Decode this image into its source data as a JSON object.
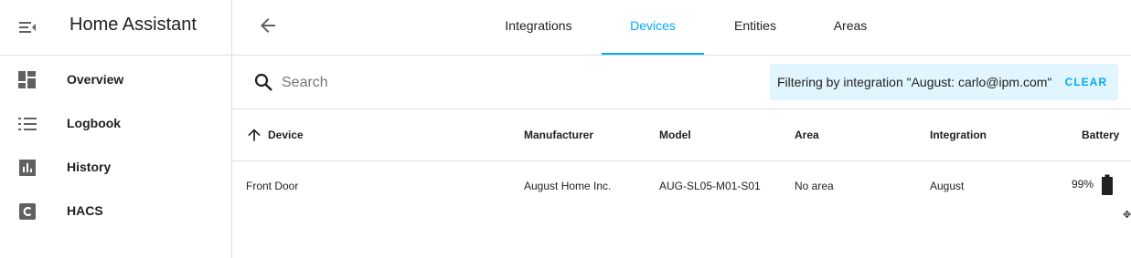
{
  "sidebar": {
    "title": "Home Assistant",
    "items": [
      {
        "label": "Overview",
        "icon": "dashboard-icon"
      },
      {
        "label": "Logbook",
        "icon": "logbook-icon"
      },
      {
        "label": "History",
        "icon": "history-chart-icon"
      },
      {
        "label": "HACS",
        "icon": "hacs-icon"
      }
    ]
  },
  "tabs": [
    {
      "label": "Integrations"
    },
    {
      "label": "Devices",
      "active": true
    },
    {
      "label": "Entities"
    },
    {
      "label": "Areas"
    }
  ],
  "search": {
    "placeholder": "Search",
    "value": ""
  },
  "filter": {
    "text": "Filtering by integration \"August: carlo@ipm.com\"",
    "clear_label": "CLEAR"
  },
  "table": {
    "columns": [
      "Device",
      "Manufacturer",
      "Model",
      "Area",
      "Integration",
      "Battery"
    ],
    "sort": {
      "column": "Device",
      "direction": "ascending"
    },
    "rows": [
      {
        "device": "Front Door",
        "manufacturer": "August Home Inc.",
        "model": "AUG-SL05-M01-S01",
        "area": "No area",
        "integration": "August",
        "battery": "99%"
      }
    ]
  },
  "colors": {
    "accent": "#03a9f4",
    "filter_bg": "#e1f5fe",
    "divider": "#e0e0e0"
  }
}
